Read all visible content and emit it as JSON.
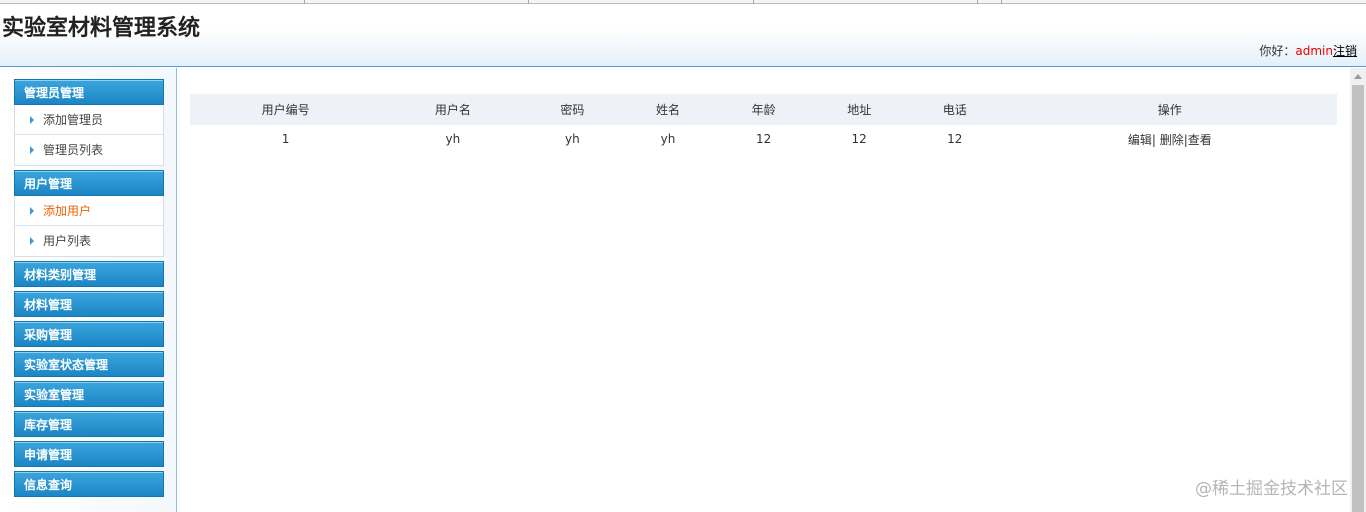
{
  "header": {
    "title": "实验室材料管理系统",
    "greeting": "你好：",
    "username": "admin",
    "logout": "注销"
  },
  "sidebar": {
    "groups": [
      {
        "label": "管理员管理",
        "items": [
          {
            "label": "添加管理员"
          },
          {
            "label": "管理员列表"
          }
        ]
      },
      {
        "label": "用户管理",
        "items": [
          {
            "label": "添加用户",
            "active": true
          },
          {
            "label": "用户列表"
          }
        ]
      },
      {
        "label": "材料类别管理"
      },
      {
        "label": "材料管理"
      },
      {
        "label": "采购管理"
      },
      {
        "label": "实验室状态管理"
      },
      {
        "label": "实验室管理"
      },
      {
        "label": "库存管理"
      },
      {
        "label": "申请管理"
      },
      {
        "label": "信息查询"
      }
    ]
  },
  "table": {
    "headers": [
      "用户编号",
      "用户名",
      "密码",
      "姓名",
      "年龄",
      "地址",
      "电话",
      "操作"
    ],
    "rows": [
      {
        "cells": [
          "1",
          "yh",
          "yh",
          "yh",
          "12",
          "12",
          "12"
        ],
        "actions": {
          "edit": "编辑|",
          "delete": "删除",
          "sep": "|",
          "view": "查看"
        }
      }
    ]
  },
  "watermark": "@稀土掘金技术社区"
}
